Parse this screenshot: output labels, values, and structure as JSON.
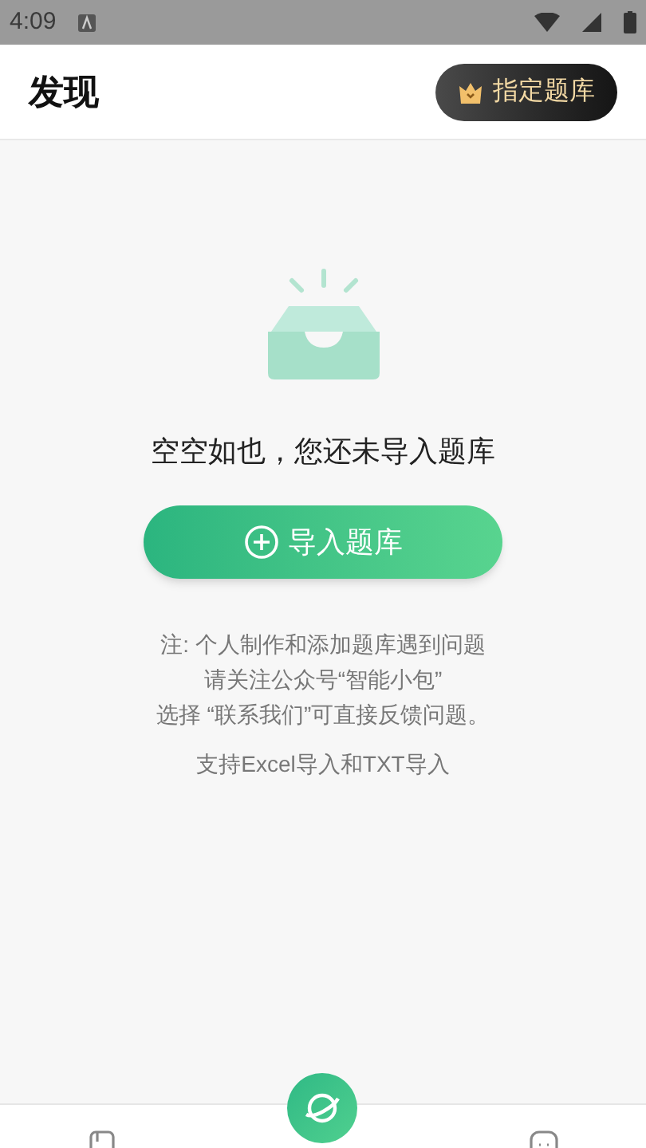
{
  "status_bar": {
    "time": "4:09"
  },
  "header": {
    "title": "发现",
    "action": "指定题库"
  },
  "empty_state": {
    "message": "空空如也，您还未导入题库",
    "button": "导入题库",
    "notes": [
      "注: 个人制作和添加题库遇到问题",
      "请关注公众号“智能小包”",
      "选择 “联系我们”可直接反馈问题。"
    ],
    "support": "支持Excel导入和TXT导入"
  },
  "bottom_nav": [
    {
      "selected": false
    },
    {
      "selected": true
    },
    {
      "selected": false
    }
  ]
}
